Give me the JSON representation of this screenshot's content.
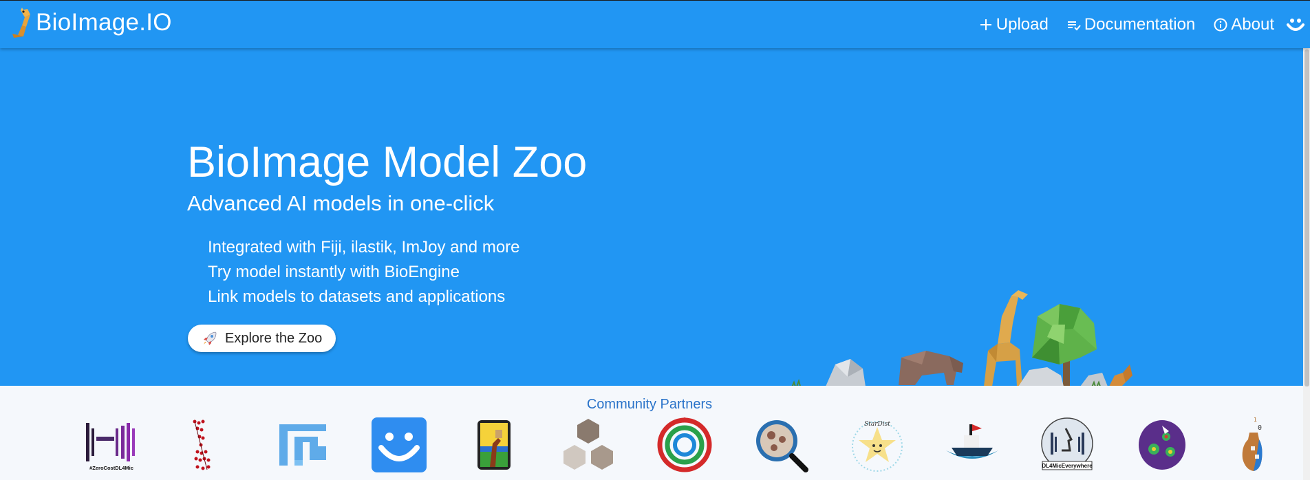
{
  "nav": {
    "brand": "BioImage.IO",
    "links": [
      {
        "label": "Upload",
        "icon": "plus-icon"
      },
      {
        "label": "Documentation",
        "icon": "checklist-icon"
      },
      {
        "label": "About",
        "icon": "info-icon"
      }
    ],
    "account_icon": "smile-icon"
  },
  "hero": {
    "title": "BioImage Model Zoo",
    "subtitle": "Advanced AI models in one-click",
    "features": [
      "Integrated with Fiji, ilastik, ImJoy and more",
      "Try model instantly with BioEngine",
      "Link models to datasets and applications"
    ],
    "cta_label": "Explore the Zoo",
    "cta_icon": "rocket-icon"
  },
  "partners": {
    "title": "Community Partners",
    "zerocost_text": "#ZeroCostDL4Mic",
    "dl4mic_text": "DL4MicEverywhere",
    "stardist_text": "StarDist",
    "logos": [
      "zerocostdl4mic",
      "deepimagej",
      "fiji",
      "imjoy",
      "ilastik",
      "hpa",
      "biapy",
      "qupath",
      "stardist",
      "hereboat",
      "dl4miceverywhere",
      "spotiflow",
      "bioimage-zoo"
    ]
  },
  "colors": {
    "primary": "#2196f3",
    "partners_title": "#2a73c9"
  }
}
